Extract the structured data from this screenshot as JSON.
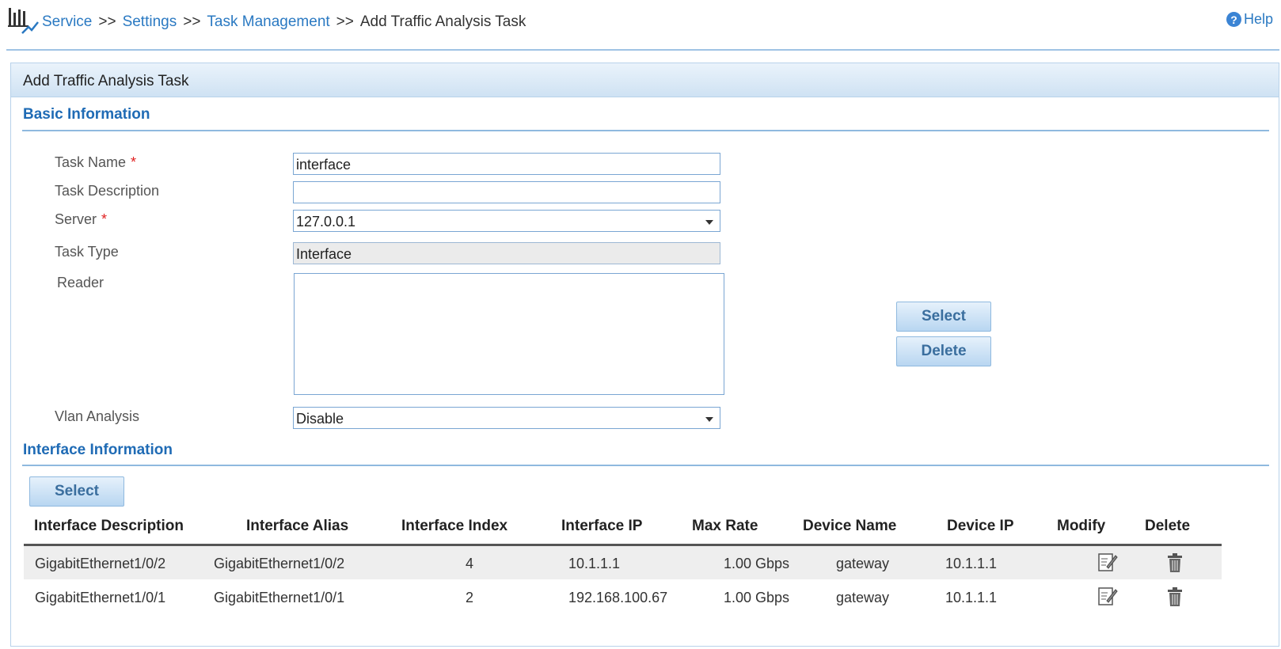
{
  "breadcrumb": {
    "items": [
      "Service",
      "Settings",
      "Task Management"
    ],
    "separator": ">>",
    "current": "Add Traffic Analysis Task"
  },
  "help_label": "Help",
  "panel_title": "Add Traffic Analysis Task",
  "basic_info": {
    "title": "Basic Information",
    "task_name_label": "Task Name",
    "task_name_value": "interface",
    "task_description_label": "Task Description",
    "task_description_value": "",
    "server_label": "Server",
    "server_value": "127.0.0.1",
    "task_type_label": "Task Type",
    "task_type_value": "Interface",
    "reader_label": "Reader",
    "select_button": "Select",
    "delete_button": "Delete",
    "vlan_label": "Vlan Analysis",
    "vlan_value": "Disable",
    "required_mark": "*"
  },
  "interface_info": {
    "title": "Interface Information",
    "select_button": "Select",
    "columns": [
      "Interface Description",
      "Interface Alias",
      "Interface Index",
      "Interface IP",
      "Max Rate",
      "Device Name",
      "Device IP",
      "Modify",
      "Delete"
    ],
    "rows": [
      {
        "description": "GigabitEthernet1/0/2",
        "alias": "GigabitEthernet1/0/2",
        "index": "4",
        "ip": "10.1.1.1",
        "max_rate": "1.00 Gbps",
        "device_name": "gateway",
        "device_ip": "10.1.1.1"
      },
      {
        "description": "GigabitEthernet1/0/1",
        "alias": "GigabitEthernet1/0/1",
        "index": "2",
        "ip": "192.168.100.67",
        "max_rate": "1.00 Gbps",
        "device_name": "gateway",
        "device_ip": "10.1.1.1"
      }
    ]
  },
  "icons": {
    "logo": "traffic-chart-icon",
    "help": "question-circle-icon",
    "modify": "edit-icon",
    "delete": "trash-icon"
  },
  "colors": {
    "link": "#2a79c2",
    "section_title": "#1f6bb5",
    "required": "#e02020"
  }
}
